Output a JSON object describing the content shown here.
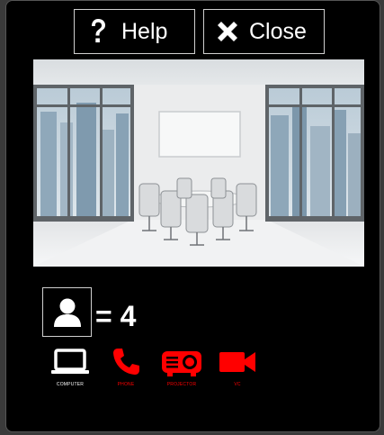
{
  "buttons": {
    "help_label": "Help",
    "close_label": "Close"
  },
  "room_photo": {
    "icon": "conference-room-photo"
  },
  "occupancy": {
    "icon": "person-icon",
    "count_text": "= 4"
  },
  "features": [
    {
      "label": "COMPUTER",
      "icon": "laptop-icon",
      "color": "#ffffff"
    },
    {
      "label": "PHONE",
      "icon": "phone-icon",
      "color": "#ff0000"
    },
    {
      "label": "PROJECTOR",
      "icon": "projector-icon",
      "color": "#ff0000"
    },
    {
      "label": "VC",
      "icon": "video-camera-icon",
      "color": "#ff0000"
    }
  ],
  "colors": {
    "background": "#000000",
    "active": "#ffffff",
    "inactive": "#ff0000"
  }
}
